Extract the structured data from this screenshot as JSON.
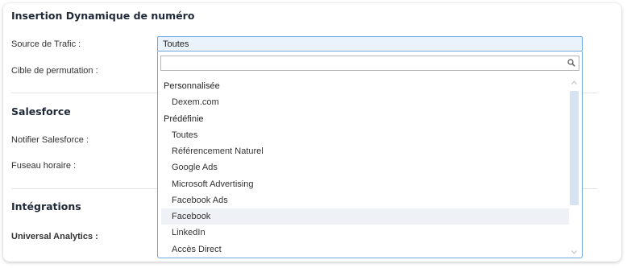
{
  "sections": {
    "dni": {
      "title": "Insertion Dynamique de numéro",
      "source_label": "Source de Trafic :",
      "target_label": "Cible de permutation :"
    },
    "salesforce": {
      "title": "Salesforce",
      "notify_label": "Notifier Salesforce :",
      "timezone_label": "Fuseau horaire :"
    },
    "integrations": {
      "title": "Intégrations",
      "ua_label": "Universal Analytics :"
    }
  },
  "traffic_source_select": {
    "selected": "Toutes",
    "search_value": "",
    "groups": [
      {
        "label": "Personnalisée",
        "options": [
          "Dexem.com"
        ]
      },
      {
        "label": "Prédéfinie",
        "options": [
          "Toutes",
          "Référencement Naturel",
          "Google Ads",
          "Microsoft Advertising",
          "Facebook Ads",
          "Facebook",
          "LinkedIn",
          "Accès Direct"
        ]
      }
    ],
    "hovered_option": "Facebook"
  },
  "icons": {
    "search": "search-icon",
    "scroll_up": "chevron-up-icon",
    "scroll_down": "chevron-down-icon"
  },
  "colors": {
    "accent_border": "#6fa8dc",
    "select_bg": "#eaf3fb",
    "hover_bg": "#eef2f7",
    "scroll_thumb": "#d6e4f1"
  }
}
